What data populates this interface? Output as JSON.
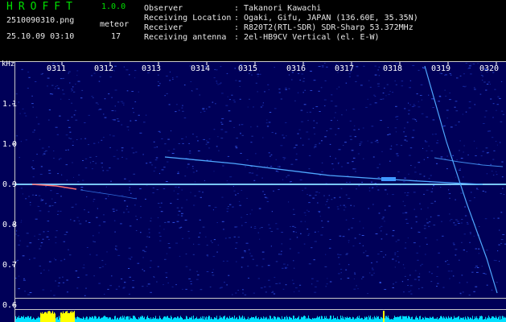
{
  "header": {
    "app_title": "HROFFT",
    "app_version": "1.0.0",
    "file_name": "2510090310.png",
    "datetime": "25.10.09 03:10",
    "meteor_label": "meteor",
    "meteor_count": "17"
  },
  "info": {
    "separator": ":",
    "rows": [
      {
        "label": "Observer",
        "value": "Takanori Kawachi"
      },
      {
        "label": "Receiving Location",
        "value": "Ogaki, Gifu, JAPAN (136.60E, 35.35N)"
      },
      {
        "label": "Receiver",
        "value": "R820T2(RTL-SDR) SDR-Sharp 53.372MHz"
      },
      {
        "label": "Receiving antenna",
        "value": "2el-HB9CV Vertical (el. E-W)"
      }
    ]
  },
  "spectrogram": {
    "unit_label": "kHz",
    "time_labels": [
      "0311",
      "0312",
      "0313",
      "0314",
      "0315",
      "0316",
      "0317",
      "0318",
      "0319",
      "0320"
    ],
    "freq_labels": [
      "1.1",
      "1.0",
      "0.9",
      "0.8",
      "0.7",
      "0.6"
    ],
    "colors": {
      "background": "#000058",
      "carrier": "#7fd0ff",
      "trace": "#4fa8ff",
      "grid": "#c8c8c8",
      "level_meter": "#00e0ff",
      "level_peak": "#ffff00"
    }
  }
}
